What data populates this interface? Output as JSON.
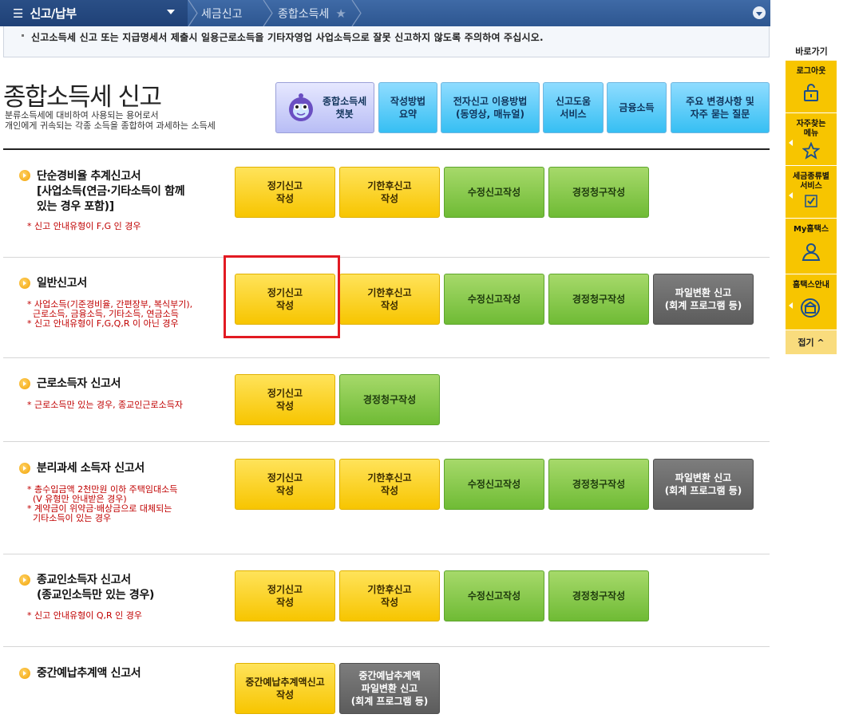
{
  "nav": {
    "menu_title": "신고/납부",
    "crumbs": [
      "세금신고",
      "종합소득세"
    ]
  },
  "notice": "신고소득세 신고 또는 지급명세서 제출시 일용근로소득을 기타자영업 사업소득으로 잘못 신고하지 않도록 주의하여 주십시오.",
  "page": {
    "title": "종합소득세 신고",
    "desc_line1": "분류소득세에 대비하여 사용되는 용어로서",
    "desc_line2": "개인에게 귀속되는 각종 소득을 종합하여 과세하는 소득세"
  },
  "top_buttons": {
    "chatbot": "종합소득세\n챗봇",
    "guide": "작성방법\n요약",
    "efiling": "전자신고 이용방법\n(동영상, 매뉴얼)",
    "help": "신고도움\n서비스",
    "finance": "금융소득",
    "faq": "주요 변경사항 및\n자주 묻는 질문"
  },
  "sections": [
    {
      "title": "단순경비율 추계신고서\n[사업소득(연금·기타소득이 함께\n있는 경우 포함)]",
      "note": "* 신고 안내유형이 F,G 인 경우",
      "buttons": [
        "정기신고\n작성",
        "기한후신고\n작성",
        "수정신고작성",
        "경정청구작성"
      ]
    },
    {
      "title": "일반신고서",
      "note": "* 사업소득(기준경비율, 간편장부, 복식부기),\n  근로소득, 금융소득, 기타소득, 연금소득\n* 신고 안내유형이 F,G,Q,R 이 아닌 경우",
      "buttons": [
        "정기신고\n작성",
        "기한후신고\n작성",
        "수정신고작성",
        "경정청구작성",
        "파일변환 신고\n(회계 프로그램 등)"
      ]
    },
    {
      "title": "근로소득자 신고서",
      "note": "* 근로소득만 있는 경우, 종교인근로소득자",
      "buttons": [
        "정기신고\n작성",
        "경정청구작성"
      ]
    },
    {
      "title": "분리과세 소득자 신고서",
      "note": "* 총수입금액 2천만원 이하 주택임대소득\n  (V 유형만 안내받은 경우)\n* 계약금이 위약금·배상금으로 대체되는\n  기타소득이 있는 경우",
      "buttons": [
        "정기신고\n작성",
        "기한후신고\n작성",
        "수정신고작성",
        "경정청구작성",
        "파일변환 신고\n(회계 프로그램 등)"
      ]
    },
    {
      "title": "종교인소득자 신고서\n(종교인소득만 있는 경우)",
      "note": "* 신고 안내유형이 Q,R 인 경우",
      "buttons": [
        "정기신고\n작성",
        "기한후신고\n작성",
        "수정신고작성",
        "경정청구작성"
      ]
    },
    {
      "title": "중간예납추계액 신고서",
      "note": "",
      "buttons": [
        "중간예납추계액신고\n작성",
        "중간예납추계액\n파일변환 신고\n(회계 프로그램 등)"
      ]
    }
  ],
  "quick_menu": {
    "header": "바로가기",
    "items": [
      "로그아웃",
      "자주찾는\n메뉴",
      "세금종류별\n서비스",
      "My홈택스",
      "홈택스안내"
    ],
    "fold": "접기 ^"
  }
}
